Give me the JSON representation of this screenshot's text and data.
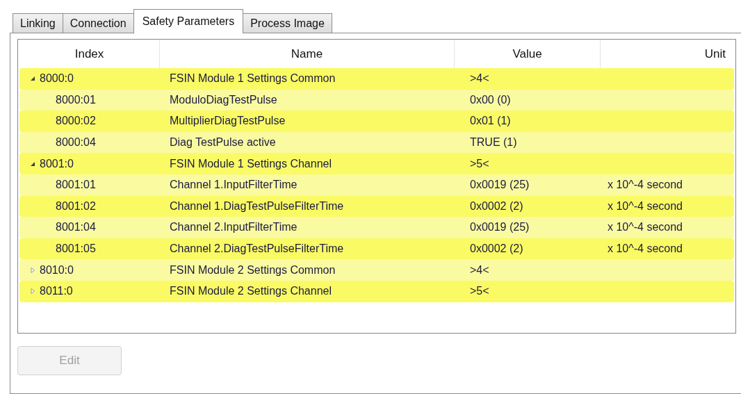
{
  "tabs": [
    {
      "label": "Linking",
      "selected": false
    },
    {
      "label": "Connection",
      "selected": false
    },
    {
      "label": "Safety Parameters",
      "selected": true
    },
    {
      "label": "Process Image",
      "selected": false
    }
  ],
  "table": {
    "columns": [
      "Index",
      "Name",
      "Value",
      "Unit"
    ],
    "rows": [
      {
        "index": "8000:0",
        "name": "FSIN Module 1 Settings Common",
        "value": ">4<",
        "expanded": true,
        "children": [
          {
            "index": "8000:01",
            "name": "ModuloDiagTestPulse",
            "value": "0x00 (0)"
          },
          {
            "index": "8000:02",
            "name": "MultiplierDiagTestPulse",
            "value": "0x01 (1)"
          },
          {
            "index": "8000:04",
            "name": "Diag TestPulse active",
            "value": "TRUE (1)"
          }
        ]
      },
      {
        "index": "8001:0",
        "name": "FSIN Module 1 Settings Channel",
        "value": ">5<",
        "expanded": true,
        "children": [
          {
            "index": "8001:01",
            "name": "Channel 1.InputFilterTime",
            "value": "0x0019 (25)",
            "unit": "x 10^-4 second"
          },
          {
            "index": "8001:02",
            "name": "Channel 1.DiagTestPulseFilterTime",
            "value": "0x0002 (2)",
            "unit": "x 10^-4 second"
          },
          {
            "index": "8001:04",
            "name": "Channel 2.InputFilterTime",
            "value": "0x0019 (25)",
            "unit": "x 10^-4 second"
          },
          {
            "index": "8001:05",
            "name": "Channel 2.DiagTestPulseFilterTime",
            "value": "0x0002 (2)",
            "unit": "x 10^-4 second"
          }
        ]
      },
      {
        "index": "8010:0",
        "name": "FSIN Module 2 Settings Common",
        "value": ">4<",
        "expanded": false
      },
      {
        "index": "8011:0",
        "name": "FSIN Module 2 Settings Channel",
        "value": ">5<",
        "expanded": false
      }
    ]
  },
  "edit_button": {
    "label": "Edit",
    "disabled": true
  }
}
